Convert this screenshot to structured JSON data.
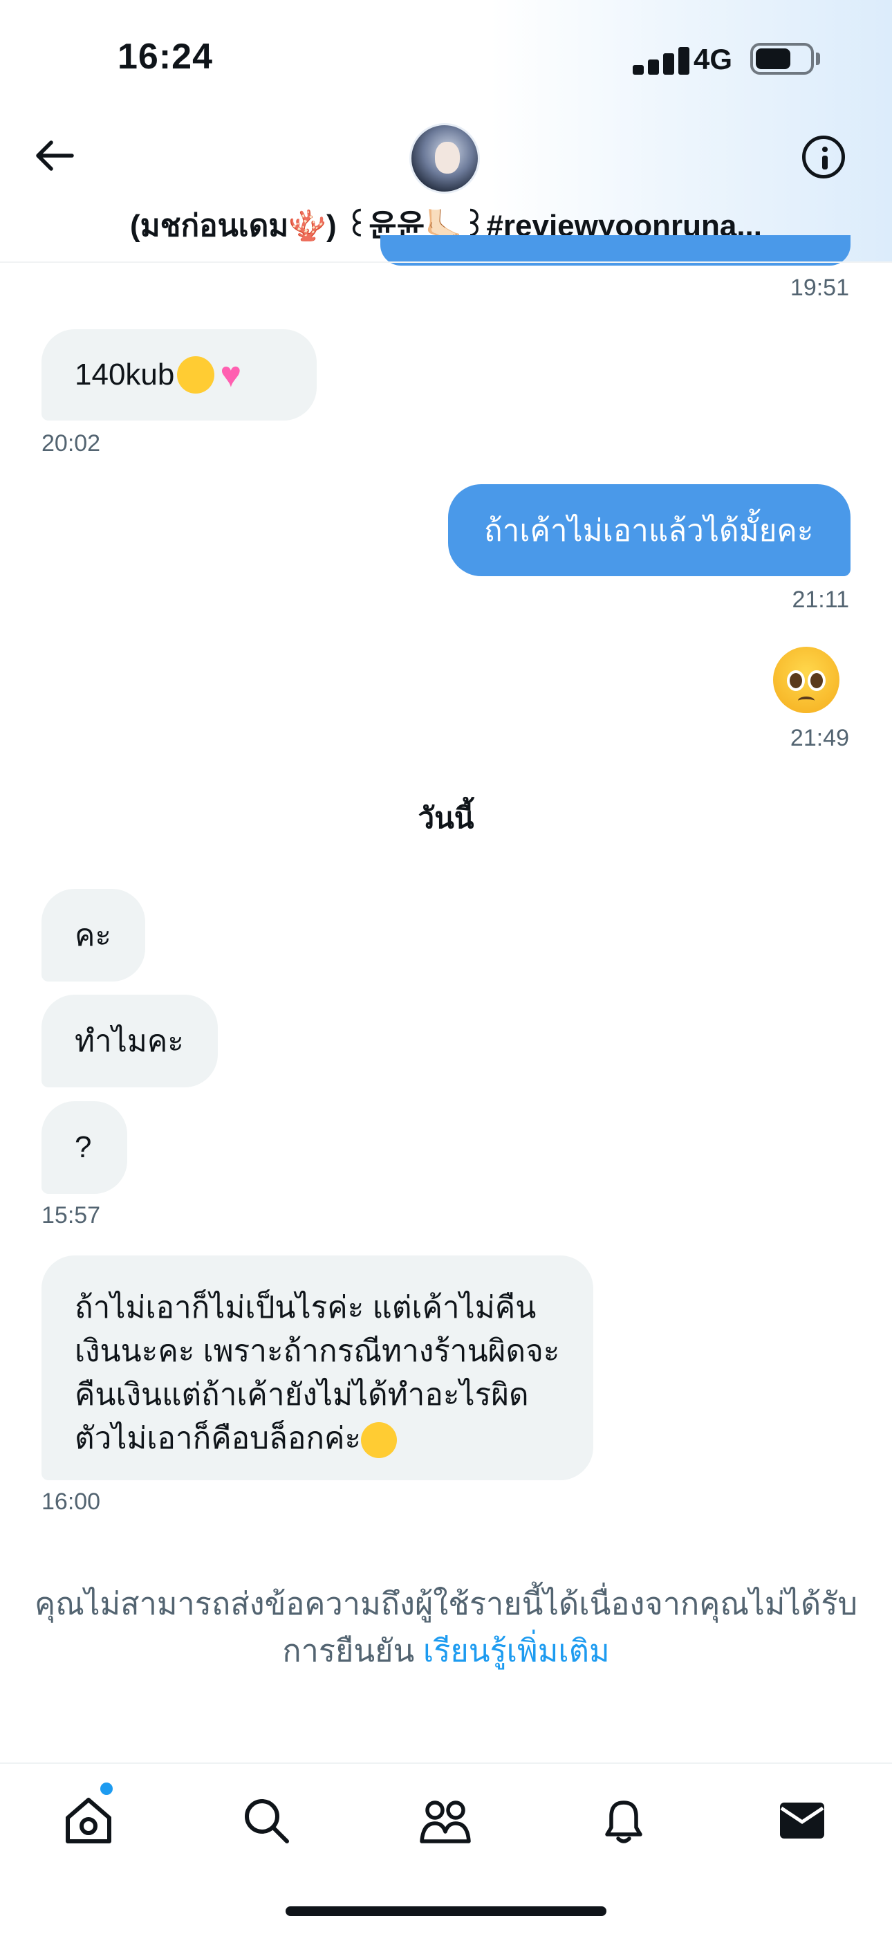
{
  "status_bar": {
    "time": "16:24",
    "network": "4G"
  },
  "header": {
    "back_icon": "arrow-left-icon",
    "info_icon": "info-icon",
    "user_name": "(มชก่อนเดม🪸) ꒰윤윤🦶🏻꒱#reviewyoonruna..."
  },
  "messages": [
    {
      "direction": "out",
      "type": "partial",
      "time": "19:51"
    },
    {
      "direction": "in",
      "text": "140kub",
      "emojis": [
        "star-struck",
        "pink-heart"
      ],
      "time": "20:02"
    },
    {
      "direction": "out",
      "text": "ถ้าเค้าไม่เอาแล้วได้มั้ยคะ",
      "time": "21:11"
    },
    {
      "direction": "out",
      "type": "emoji",
      "emoji": "pleading-face",
      "time": "21:49"
    }
  ],
  "day_separator": "วันนี้",
  "today_messages": [
    {
      "direction": "in",
      "text": "คะ"
    },
    {
      "direction": "in",
      "text": "ทำไมคะ"
    },
    {
      "direction": "in",
      "text": "?",
      "time": "15:57"
    },
    {
      "direction": "in",
      "lines": [
        "ถ้าไม่เอาก็ไม่เป็นไรค่ะ แต่เค้าไม่คืน",
        "เงินนะคะ เพราะถ้ากรณีทางร้านผิดจะ",
        "คืนเงินแต่ถ้าเค้ายังไม่ได้ทำอะไรผิด",
        "ตัวไม่เอาก็คือบล็อกค่ะ"
      ],
      "emoji": "winking-face",
      "time": "16:00"
    }
  ],
  "notice": {
    "text": "คุณไม่สามารถส่งข้อความถึงผู้ใช้รายนี้ได้เนื่องจากคุณไม่ได้รับการยืนยัน",
    "link": "เรียนรู้เพิ่มเติม"
  },
  "bottom_nav": {
    "items": [
      "home-icon",
      "search-icon",
      "communities-icon",
      "notifications-icon",
      "messages-icon"
    ],
    "accent_color": "#1d9bf0"
  },
  "colors": {
    "outgoing_bubble": "#4a99e9",
    "incoming_bubble": "#eff3f4",
    "muted_text": "#536471"
  }
}
